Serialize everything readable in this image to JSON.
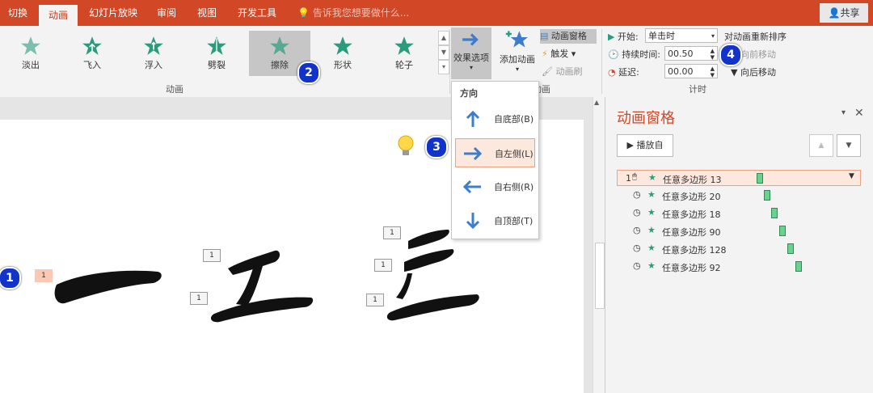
{
  "tabs": [
    {
      "label": "切换",
      "active": false
    },
    {
      "label": "动画",
      "active": true
    },
    {
      "label": "幻灯片放映",
      "active": false
    },
    {
      "label": "审阅",
      "active": false
    },
    {
      "label": "视图",
      "active": false
    },
    {
      "label": "开发工具",
      "active": false
    }
  ],
  "tell_me": "告诉我您想要做什么...",
  "share": "共享",
  "gallery": [
    {
      "label": "淡出",
      "selected": false
    },
    {
      "label": "飞入",
      "selected": false
    },
    {
      "label": "浮入",
      "selected": false
    },
    {
      "label": "劈裂",
      "selected": false
    },
    {
      "label": "擦除",
      "selected": true
    },
    {
      "label": "形状",
      "selected": false
    },
    {
      "label": "轮子",
      "selected": false
    }
  ],
  "groups": {
    "animation": "动画",
    "advanced": "级动画",
    "timing": "计时"
  },
  "effect_options": "效果选项",
  "add_animation": "添加动画",
  "animation_pane_btn": "动画窗格",
  "trigger": "触发",
  "animation_painter": "动画刷",
  "timing": {
    "start_label": "开始:",
    "start_value": "单击时",
    "duration_label": "持续时间:",
    "duration_value": "00.50",
    "delay_label": "延迟:",
    "delay_value": "00.00",
    "reorder": "对动画重新排序",
    "move_earlier": "向前移动",
    "move_later": "向后移动"
  },
  "dropdown": {
    "header": "方向",
    "items": [
      {
        "label": "自底部(B)",
        "selected": false
      },
      {
        "label": "自左侧(L)",
        "selected": true
      },
      {
        "label": "自右侧(R)",
        "selected": false
      },
      {
        "label": "自顶部(T)",
        "selected": false
      }
    ]
  },
  "pane": {
    "title": "动画窗格",
    "play_from": "播放自",
    "items": [
      {
        "num": "1",
        "label": "任意多边形 13"
      },
      {
        "num": "",
        "label": "任意多边形 20"
      },
      {
        "num": "",
        "label": "任意多边形 18"
      },
      {
        "num": "",
        "label": "任意多边形 90"
      },
      {
        "num": "",
        "label": "任意多边形 128"
      },
      {
        "num": "",
        "label": "任意多边形 92"
      }
    ]
  },
  "slide_badges": [
    "1",
    "1",
    "1",
    "1",
    "1",
    "1"
  ],
  "callouts": [
    "1",
    "2",
    "3",
    "4"
  ],
  "colors": {
    "accent": "#d24726",
    "star": "#2b9b7e",
    "callout": "#1133cc",
    "arrow": "#3d7dcb"
  }
}
